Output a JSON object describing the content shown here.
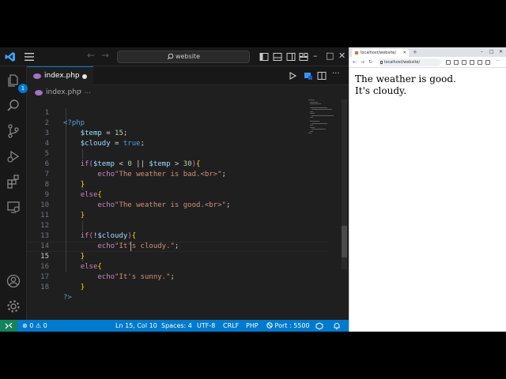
{
  "titlebar": {
    "search_label": "website"
  },
  "activity": {
    "source_control_badge": "1"
  },
  "tab": {
    "filename": "index.php"
  },
  "breadcrumb": {
    "file": "index.php",
    "separator": "› ..."
  },
  "editor": {
    "active_line": 15,
    "lines": [
      {
        "n": "1",
        "text": "<?php"
      },
      {
        "n": "2",
        "text": "    $temp = 15;"
      },
      {
        "n": "3",
        "text": "    $cloudy = true;"
      },
      {
        "n": "4",
        "text": ""
      },
      {
        "n": "5",
        "text": "    if($temp < 0 || $temp > 30){"
      },
      {
        "n": "6",
        "text": "        echo\"The weather is bad.<br>\";"
      },
      {
        "n": "7",
        "text": "    }"
      },
      {
        "n": "8",
        "text": "    else{"
      },
      {
        "n": "9",
        "text": "        echo\"The weather is good.<br>\";"
      },
      {
        "n": "10",
        "text": "    }"
      },
      {
        "n": "11",
        "text": ""
      },
      {
        "n": "12",
        "text": "    if(!$cloudy){"
      },
      {
        "n": "13",
        "text": "        echo\"It's cloudy.\";"
      },
      {
        "n": "14",
        "text": "    }"
      },
      {
        "n": "15",
        "text": "    else{"
      },
      {
        "n": "16",
        "text": "        echo\"It's sunny.\";"
      },
      {
        "n": "17",
        "text": "    }"
      },
      {
        "n": "18",
        "text": "?>"
      }
    ]
  },
  "statusbar": {
    "problems": "⊗ 0 ⚠ 0",
    "position": "Ln 15, Col 10",
    "spaces": "Spaces: 4",
    "encoding": "UTF-8",
    "eol": "CRLF",
    "language": "PHP",
    "port": "Port : 5500"
  },
  "browser": {
    "tab_title": "localhost/website/",
    "url": "localhost/website/",
    "output": [
      "The weather is good.",
      "It's cloudy."
    ]
  },
  "colors": {
    "statusbar": "#007acc",
    "remote": "#16825d",
    "accent": "#0078d4"
  }
}
